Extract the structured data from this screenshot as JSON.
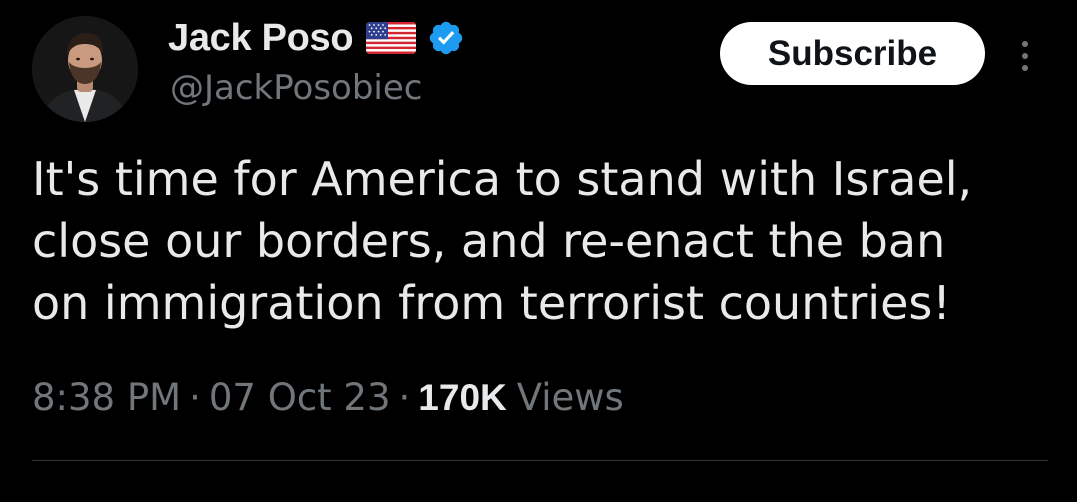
{
  "author": {
    "display_name": "Jack Poso",
    "handle": "@JackPosobiec",
    "verified": true,
    "flag_icon": "us-flag-icon",
    "badge_color": "#1d9bf0"
  },
  "actions": {
    "subscribe_label": "Subscribe",
    "more_icon": "more-vertical-icon"
  },
  "tweet": {
    "lines": [
      "It's time for America to stand with Israel,",
      "close our borders, and re-enact the ban",
      "on immigration from terrorist countries!"
    ]
  },
  "meta": {
    "time": "8:38 PM",
    "separator": "·",
    "date": "07 Oct 23",
    "views_count": "170K",
    "views_label": "Views"
  },
  "colors": {
    "background": "#000000",
    "text_primary": "#e7e9ea",
    "text_secondary": "#71767b",
    "divider": "#2f3336"
  }
}
